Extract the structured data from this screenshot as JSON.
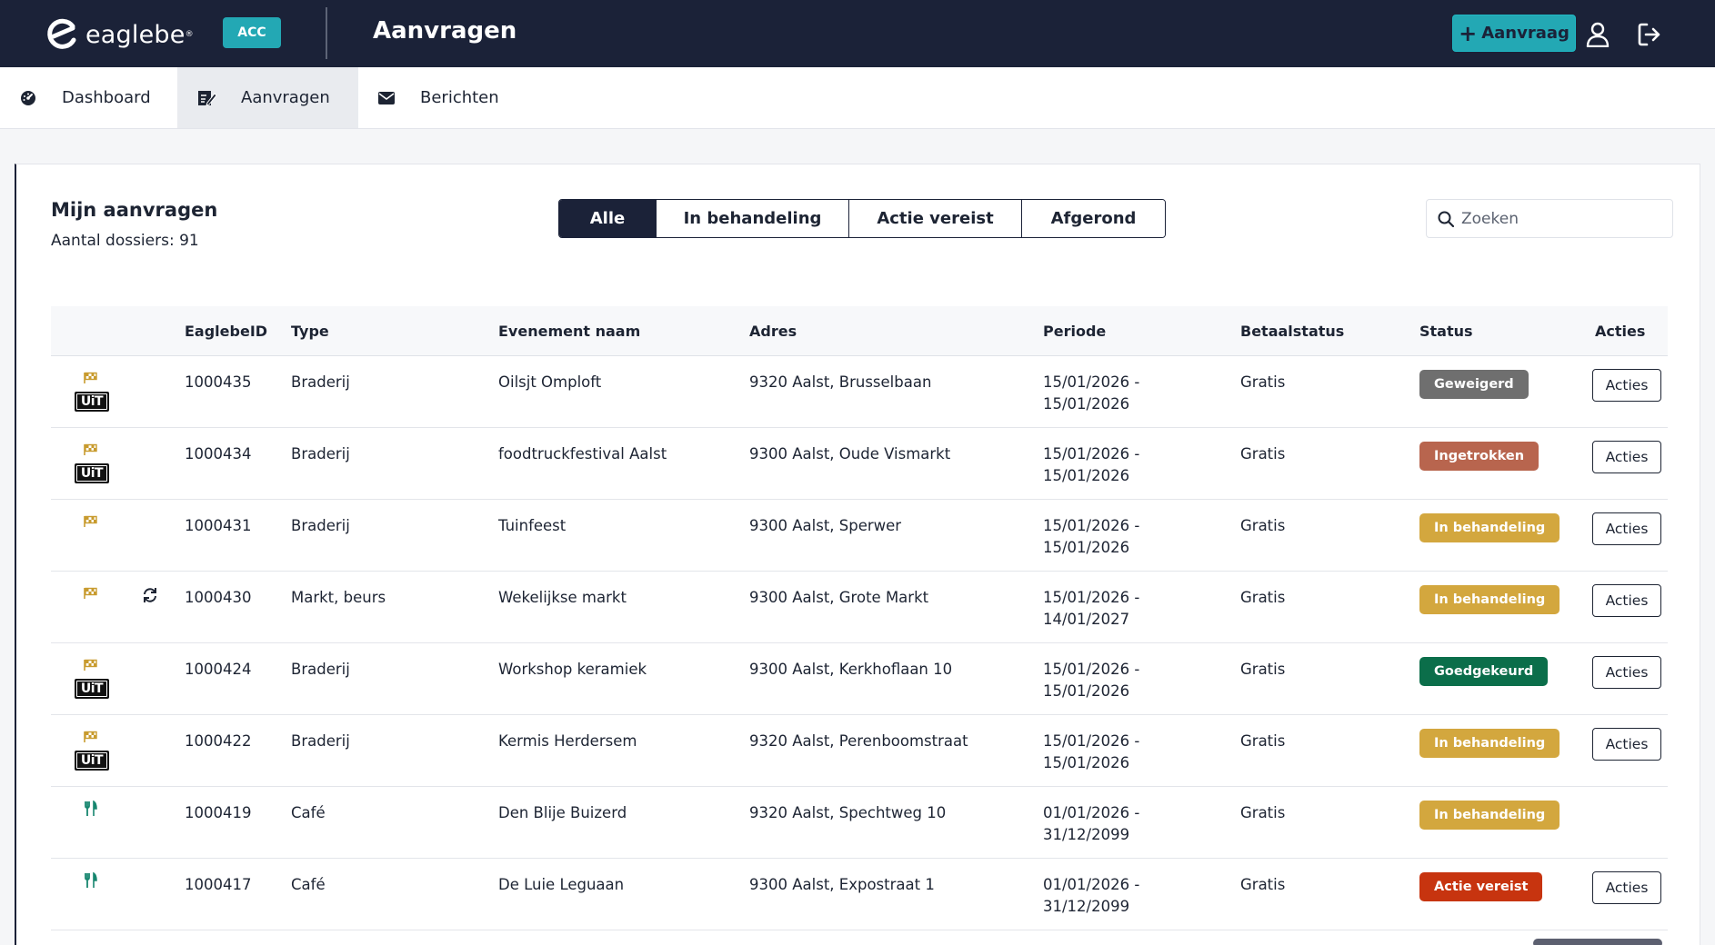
{
  "header": {
    "brand": "eaglebe",
    "brand_reg": "®",
    "env_badge": "ACC",
    "title": "Aanvragen",
    "new_request_label": "Aanvraag",
    "colors": {
      "bar": "#1b2238",
      "accent": "#23a8b4"
    }
  },
  "nav": {
    "items": [
      {
        "label": "Dashboard",
        "icon": "gauge-icon",
        "active": false
      },
      {
        "label": "Aanvragen",
        "icon": "edit-form-icon",
        "active": true
      },
      {
        "label": "Berichten",
        "icon": "envelope-icon",
        "active": false
      }
    ]
  },
  "main": {
    "title": "Mijn aanvragen",
    "count_label": "Aantal dossiers: 91",
    "filters": [
      {
        "label": "Alle",
        "active": true
      },
      {
        "label": "In behandeling",
        "active": false
      },
      {
        "label": "Actie vereist",
        "active": false
      },
      {
        "label": "Afgerond",
        "active": false
      }
    ],
    "search_placeholder": "Zoeken"
  },
  "table": {
    "columns": [
      "",
      "EaglebeID",
      "Type",
      "Evenement naam",
      "Adres",
      "Periode",
      "Betaalstatus",
      "Status",
      "Acties"
    ],
    "rows": [
      {
        "icons": [
          "flag-icon",
          "uit-icon"
        ],
        "id": "1000435",
        "type": "Braderij",
        "name": "Oilsjt Omploft",
        "address": "9320 Aalst, Brusselbaan",
        "period_start": "15/01/2026 -",
        "period_end": "15/01/2026",
        "payment": "Gratis",
        "status": "Geweigerd",
        "status_color": "#6f6f6f",
        "actions": "Acties"
      },
      {
        "icons": [
          "flag-icon",
          "uit-icon"
        ],
        "id": "1000434",
        "type": "Braderij",
        "name": "foodtruckfestival Aalst",
        "address": "9300 Aalst, Oude Vismarkt",
        "period_start": "15/01/2026 -",
        "period_end": "15/01/2026",
        "payment": "Gratis",
        "status": "Ingetrokken",
        "status_color": "#b8654e",
        "actions": "Acties"
      },
      {
        "icons": [
          "flag-icon"
        ],
        "id": "1000431",
        "type": "Braderij",
        "name": "Tuinfeest",
        "address": "9300 Aalst, Sperwer",
        "period_start": "15/01/2026 -",
        "period_end": "15/01/2026",
        "payment": "Gratis",
        "status": "In behandeling",
        "status_color": "#d3a73e",
        "actions": "Acties"
      },
      {
        "icons": [
          "flag-icon",
          "repeat-icon"
        ],
        "id": "1000430",
        "type": "Markt, beurs",
        "name": "Wekelijkse markt",
        "address": "9300 Aalst, Grote Markt",
        "period_start": "15/01/2026 -",
        "period_end": "14/01/2027",
        "payment": "Gratis",
        "status": "In behandeling",
        "status_color": "#d3a73e",
        "actions": "Acties"
      },
      {
        "icons": [
          "flag-icon",
          "uit-icon"
        ],
        "id": "1000424",
        "type": "Braderij",
        "name": "Workshop keramiek",
        "address": "9300 Aalst, Kerkhoflaan 10",
        "period_start": "15/01/2026 -",
        "period_end": "15/01/2026",
        "payment": "Gratis",
        "status": "Goedgekeurd",
        "status_color": "#0b6e4a",
        "actions": "Acties"
      },
      {
        "icons": [
          "flag-icon",
          "uit-icon"
        ],
        "id": "1000422",
        "type": "Braderij",
        "name": "Kermis Herdersem",
        "address": "9320 Aalst, Perenboomstraat",
        "period_start": "15/01/2026 -",
        "period_end": "15/01/2026",
        "payment": "Gratis",
        "status": "In behandeling",
        "status_color": "#d3a73e",
        "actions": "Acties"
      },
      {
        "icons": [
          "fork-icon"
        ],
        "id": "1000419",
        "type": "Café",
        "name": "Den Blije Buizerd",
        "address": "9320 Aalst, Spechtweg 10",
        "period_start": "01/01/2026 -",
        "period_end": "31/12/2099",
        "payment": "Gratis",
        "status": "In behandeling",
        "status_color": "#d3a73e",
        "actions": ""
      },
      {
        "icons": [
          "fork-icon"
        ],
        "id": "1000417",
        "type": "Café",
        "name": "De Luie Leguaan",
        "address": "9300 Aalst, Expostraat 1",
        "period_start": "01/01/2026 -",
        "period_end": "31/12/2099",
        "payment": "Gratis",
        "status": "Actie vereist",
        "status_color": "#c7340f",
        "actions": "Acties"
      }
    ]
  },
  "uit_label": "UiT"
}
